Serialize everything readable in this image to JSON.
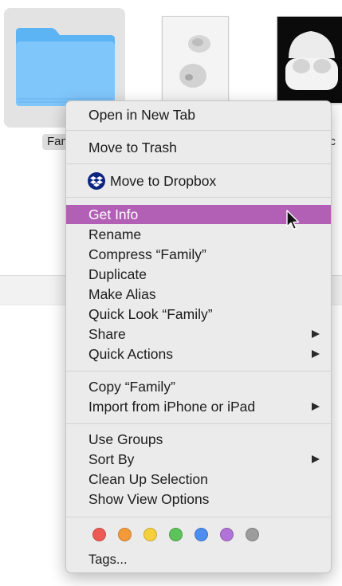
{
  "finder": {
    "folder_name": "Fam",
    "file2_name": "uc"
  },
  "menu": {
    "sections": [
      [
        "Open in New Tab"
      ],
      [
        "Move to Trash"
      ],
      [
        "Move to Dropbox"
      ],
      [
        "Get Info",
        "Rename",
        "Compress “Family”",
        "Duplicate",
        "Make Alias",
        "Quick Look “Family”",
        "Share",
        "Quick Actions"
      ],
      [
        "Copy “Family”",
        "Import from iPhone or iPad"
      ],
      [
        "Use Groups",
        "Sort By",
        "Clean Up Selection",
        "Show View Options"
      ],
      [
        "Tags..."
      ]
    ],
    "highlighted": "Get Info",
    "submenu_items": [
      "Share",
      "Quick Actions",
      "Import from iPhone or iPad",
      "Sort By"
    ],
    "highlight_color": "#b260b6"
  },
  "tags": [
    {
      "name": "red",
      "color": "#ee5b54"
    },
    {
      "name": "orange",
      "color": "#f39a3a"
    },
    {
      "name": "yellow",
      "color": "#f6cf3c"
    },
    {
      "name": "green",
      "color": "#5cc35b"
    },
    {
      "name": "blue",
      "color": "#4c8df1"
    },
    {
      "name": "purple",
      "color": "#b172d9"
    },
    {
      "name": "gray",
      "color": "#9c9c9c"
    }
  ]
}
